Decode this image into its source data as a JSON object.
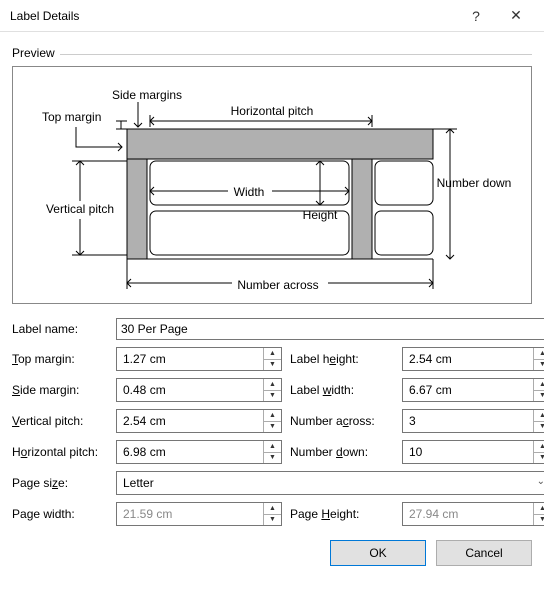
{
  "window": {
    "title": "Label Details",
    "help": "?",
    "close": "✕"
  },
  "preview": {
    "legend": "Preview",
    "side_margins": "Side margins",
    "top_margin": "Top margin",
    "horizontal_pitch": "Horizontal pitch",
    "vertical_pitch": "Vertical pitch",
    "width": "Width",
    "height": "Height",
    "number_down": "Number down",
    "number_across": "Number across"
  },
  "fields": {
    "label_name_label": "Label name:",
    "label_name_value": "30 Per Page",
    "top_margin_label_pre": "",
    "top_margin_u": "T",
    "top_margin_label_post": "op margin:",
    "top_margin_value": "1.27 cm",
    "side_margin_u": "S",
    "side_margin_post": "ide margin:",
    "side_margin_value": "0.48 cm",
    "vpitch_u": "V",
    "vpitch_post": "ertical pitch:",
    "vpitch_value": "2.54 cm",
    "hpitch_pre": "H",
    "hpitch_u": "o",
    "hpitch_post": "rizontal pitch:",
    "hpitch_value": "6.98 cm",
    "psize_pre": "Page si",
    "psize_u": "z",
    "psize_post": "e:",
    "psize_value": "Letter",
    "pwidth_pre": "Pa",
    "pwidth_u": "g",
    "pwidth_post": "e width:",
    "pwidth_value": "21.59 cm",
    "lheight_pre": "Label h",
    "lheight_u": "e",
    "lheight_post": "ight:",
    "lheight_value": "2.54 cm",
    "lwidth_pre": "Label ",
    "lwidth_u": "w",
    "lwidth_post": "idth:",
    "lwidth_value": "6.67 cm",
    "nacross_pre": "Number a",
    "nacross_u": "c",
    "nacross_post": "ross:",
    "nacross_value": "3",
    "ndown_pre": "Number ",
    "ndown_u": "d",
    "ndown_post": "own:",
    "ndown_value": "10",
    "pheight_pre": "Page ",
    "pheight_u": "H",
    "pheight_post": "eight:",
    "pheight_value": "27.94 cm"
  },
  "buttons": {
    "ok": "OK",
    "cancel": "Cancel"
  }
}
